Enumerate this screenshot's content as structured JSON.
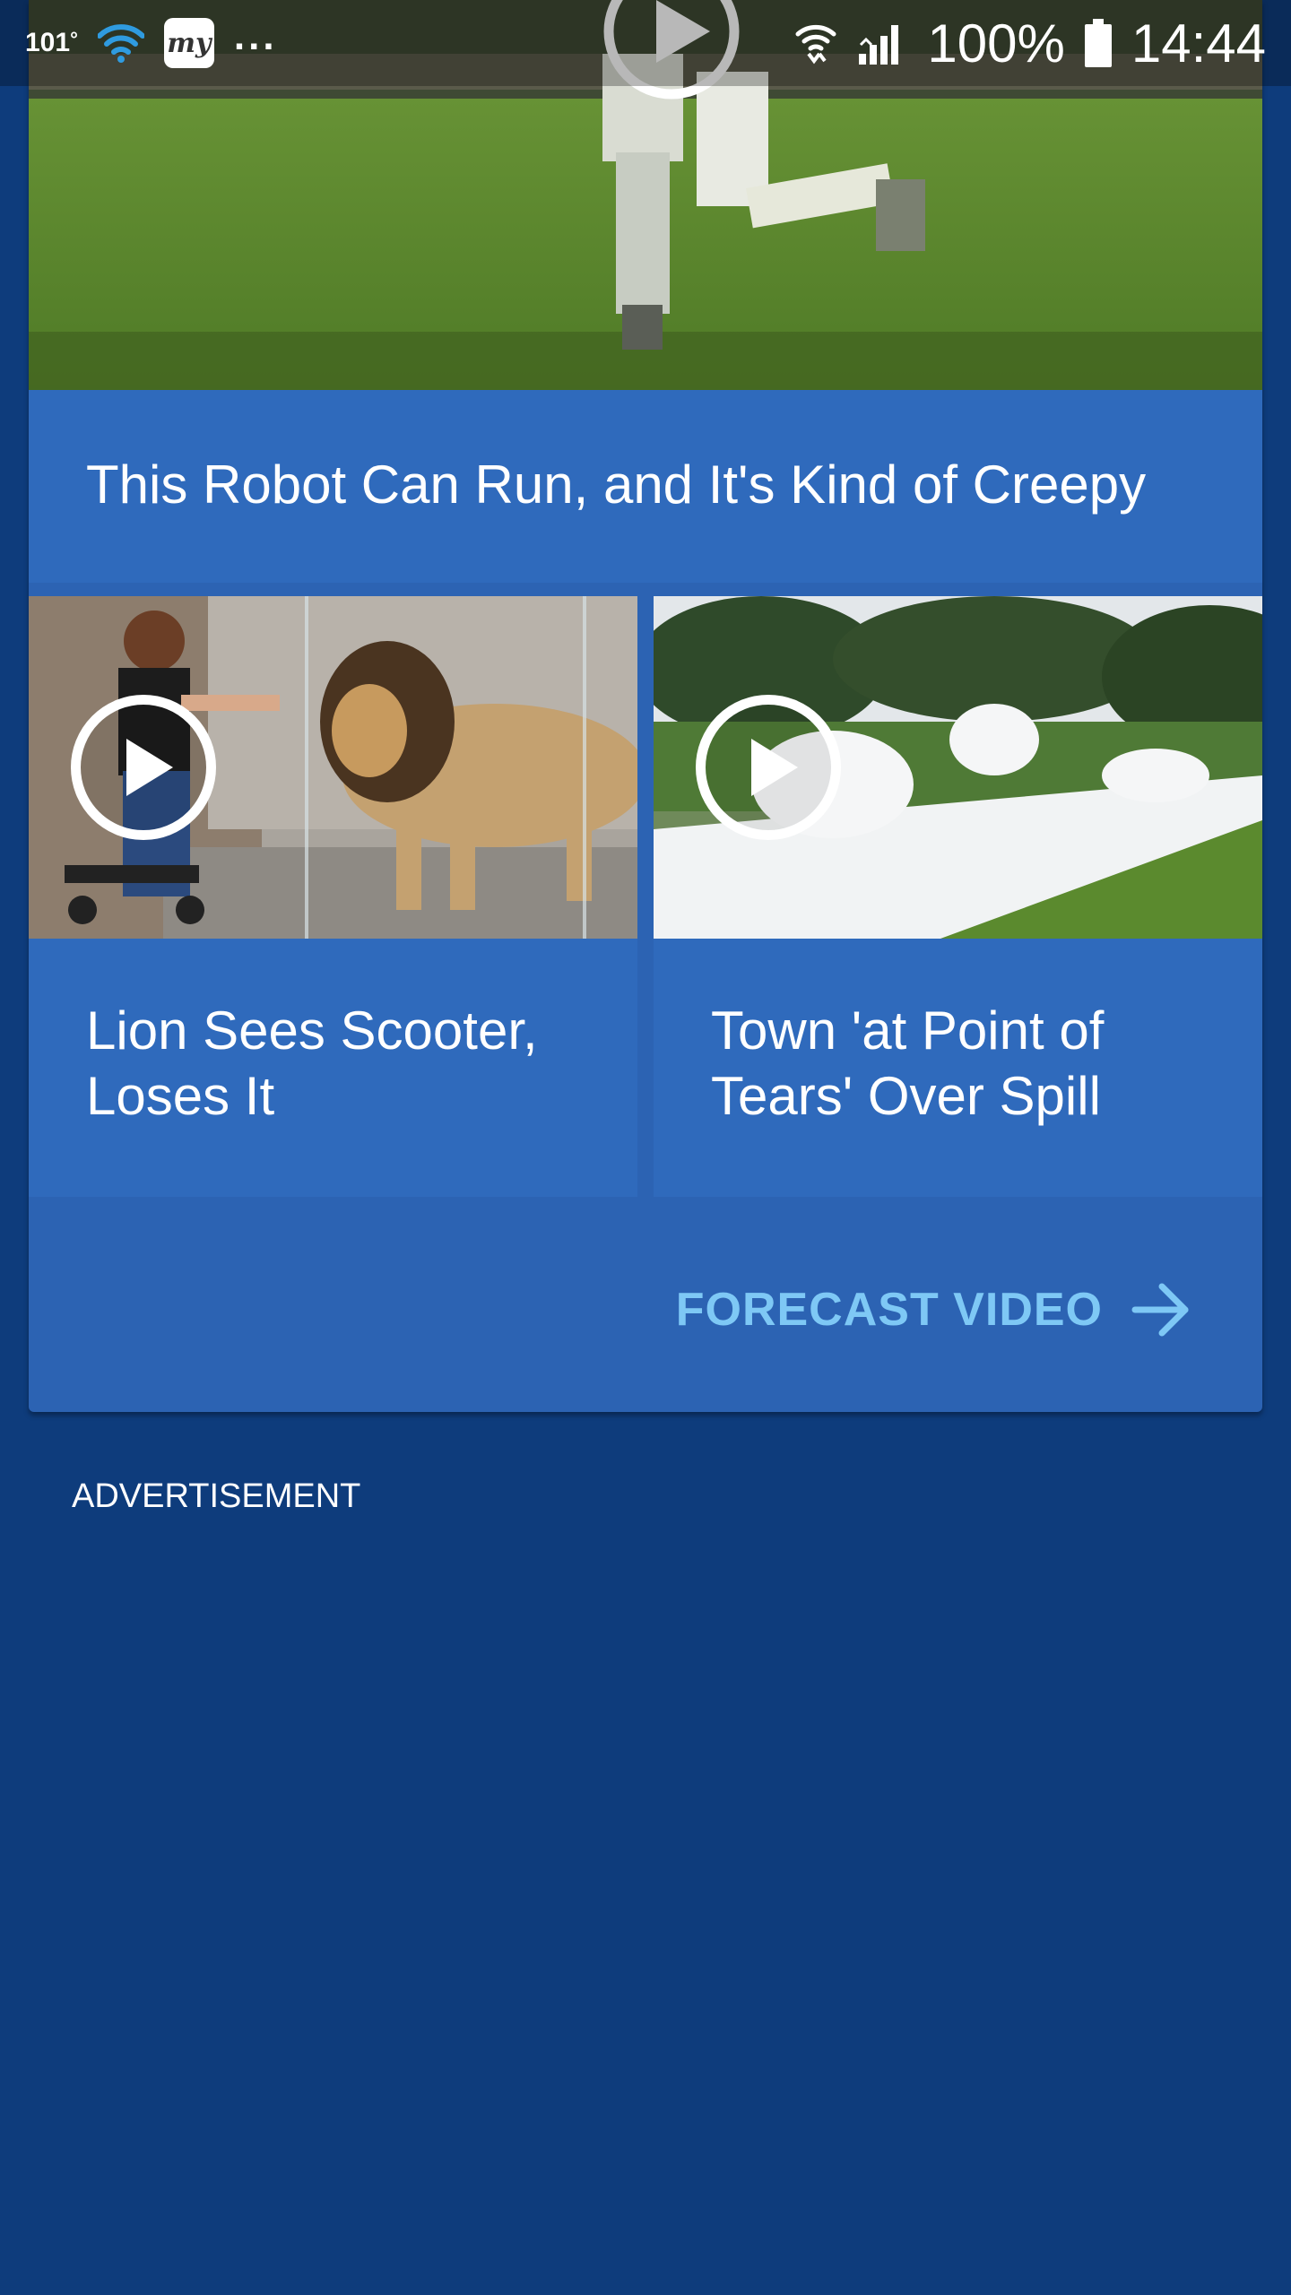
{
  "status_bar": {
    "temperature": "101",
    "temperature_unit": "°",
    "app_icon_label": "my",
    "more_indicator": "...",
    "battery_percent": "100%",
    "time": "14:44",
    "icons": [
      "wifi-icon",
      "my-app-icon",
      "wifi-calling-icon",
      "signal-icon",
      "battery-icon"
    ]
  },
  "featured_video": {
    "title": "This Robot Can Run, and It's Kind of Creepy"
  },
  "videos": [
    {
      "title": "Lion Sees Scooter, Loses It"
    },
    {
      "title": "Town 'at Point of Tears' Over Spill"
    }
  ],
  "forecast_link": {
    "label": "FORECAST VIDEO"
  },
  "advertisement": {
    "label": "ADVERTISEMENT"
  },
  "colors": {
    "background": "#0e3c7c",
    "card": "#2f6abc",
    "link": "#7ec8f5"
  }
}
